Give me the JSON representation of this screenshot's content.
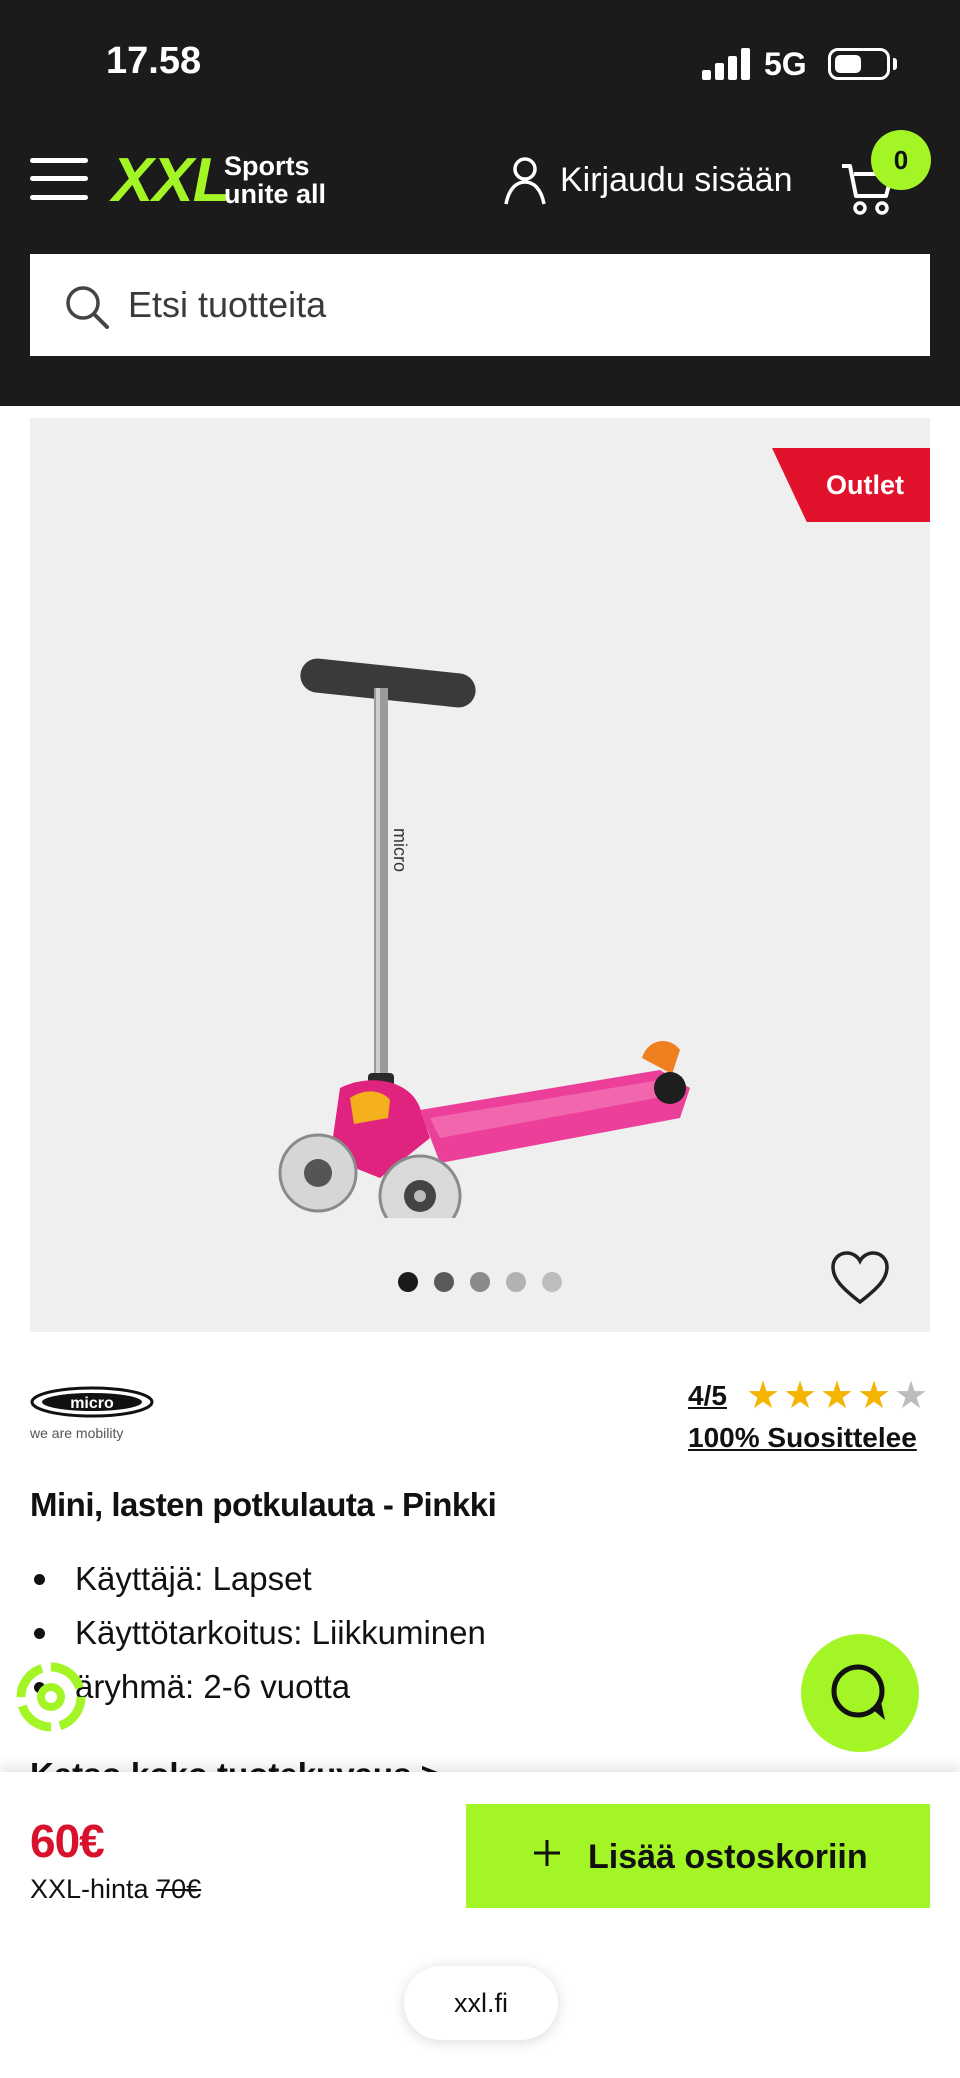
{
  "status_bar": {
    "time": "17.58",
    "network": "5G"
  },
  "header": {
    "logo": "XXL",
    "tagline": "Sports unite all",
    "login": "Kirjaudu sisään",
    "cart_count": "0",
    "search_placeholder": "Etsi tuotteita"
  },
  "product": {
    "badge": "Outlet",
    "brand": "micro",
    "brand_slogan": "we are mobility",
    "rating": "4/5",
    "stars": 4,
    "recommend": "100% Suosittelee",
    "title": "Mini, lasten potkulauta - Pinkki",
    "bullets": [
      "Käyttäjä: Lapset",
      "Käyttötarkoitus: Liikkuminen",
      "äryhmä: 2-6 vuotta"
    ],
    "see_more": "Katso koko tuotekuvaus >",
    "carousel_count": 5,
    "carousel_active": 0
  },
  "purchase": {
    "price": "60€",
    "xxl_price_label": "XXL-hinta",
    "old_price": "70€",
    "add_to_cart": "Lisää ostoskoriin"
  },
  "browser": {
    "url": "xxl.fi"
  },
  "colors": {
    "accent": "#a4f526",
    "sale": "#e1122c",
    "header": "#1b1b1b"
  }
}
